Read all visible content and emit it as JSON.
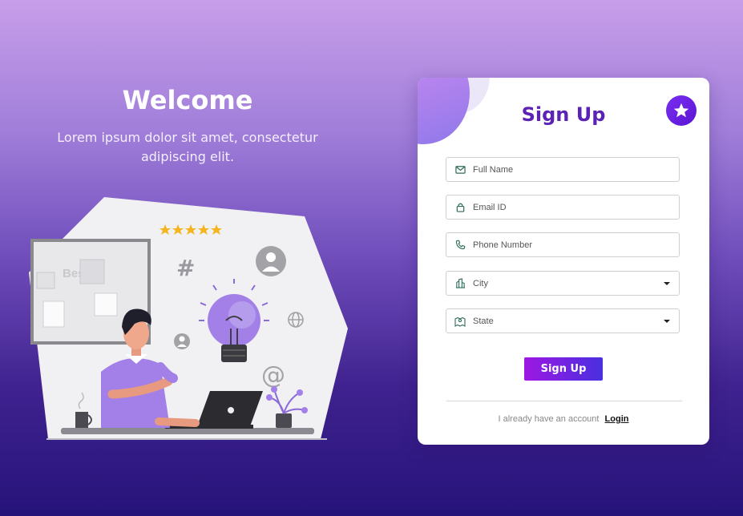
{
  "welcome": {
    "title": "Welcome",
    "text": "Lorem ipsum dolor sit amet, consectetur adipiscing elit."
  },
  "illustration": {
    "board_text": "Best",
    "hash_symbol": "#",
    "at_symbol": "@",
    "rating_stars": 5
  },
  "form": {
    "title": "Sign Up",
    "fields": {
      "full_name": {
        "placeholder": "Full Name",
        "icon": "mail-icon"
      },
      "email": {
        "placeholder": "Email ID",
        "icon": "lock-icon"
      },
      "phone": {
        "placeholder": "Phone Number",
        "icon": "phone-icon"
      },
      "city": {
        "value": "City",
        "icon": "building-icon"
      },
      "state": {
        "value": "State",
        "icon": "map-icon"
      }
    },
    "submit_label": "Sign Up",
    "account_prompt": "I already have an account",
    "login_label": "Login"
  },
  "colors": {
    "accent": "#5a22b5",
    "button_start": "#9d18e3",
    "button_end": "#4a2fe0",
    "badge": "#6a22e6"
  }
}
